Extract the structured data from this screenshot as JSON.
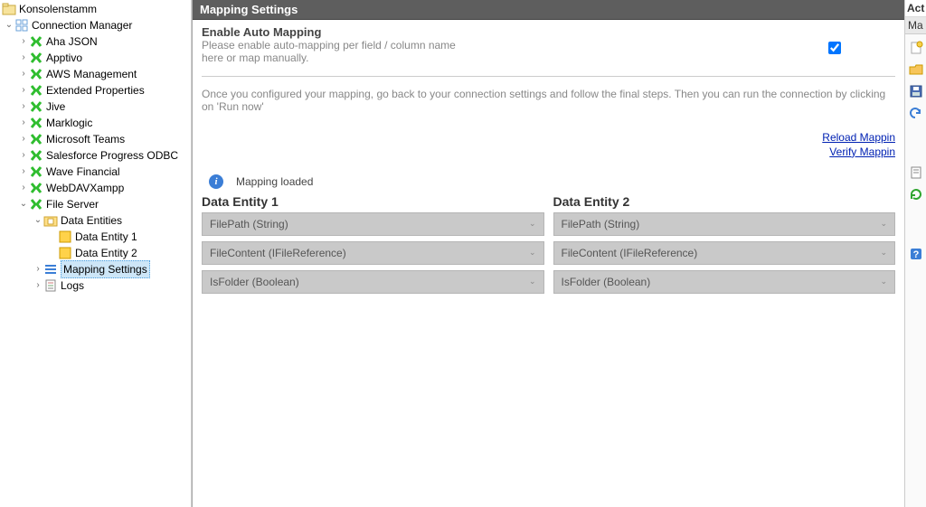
{
  "tree": {
    "root": "Konsolenstamm",
    "manager": "Connection Manager",
    "connections": [
      "Aha JSON",
      "Apptivo",
      "AWS Management",
      "Extended Properties",
      "Jive",
      "Marklogic",
      "Microsoft Teams",
      "Salesforce Progress ODBC",
      "Wave Financial",
      "WebDAVXampp"
    ],
    "file_server": "File Server",
    "data_entities": "Data Entities",
    "entity1": "Data Entity 1",
    "entity2": "Data Entity 2",
    "mapping_settings": "Mapping Settings",
    "logs": "Logs"
  },
  "panel": {
    "title": "Mapping Settings",
    "auto_map_title": "Enable Auto Mapping",
    "auto_map_desc1": "Please enable auto-mapping per field / column name",
    "auto_map_desc2": "here or map manually.",
    "hint": "Once you configured your mapping, go back to your connection settings and follow the final steps. Then you can run the connection by clicking on 'Run now'",
    "reload_link": "Reload Mappin",
    "verify_link": "Verify Mappin",
    "status": "Mapping loaded",
    "entity1_title": "Data Entity 1",
    "entity2_title": "Data Entity 2",
    "fields": [
      "FilePath (String)",
      "FileContent (IFileReference)",
      "IsFolder (Boolean)"
    ]
  },
  "right": {
    "header": "Act",
    "tab": "Ma"
  },
  "colors": {
    "conn_icon": "#2fbd2f",
    "header_bg": "#5e5e5e",
    "link": "#0021b3",
    "select_bg": "#c9c9c9"
  }
}
